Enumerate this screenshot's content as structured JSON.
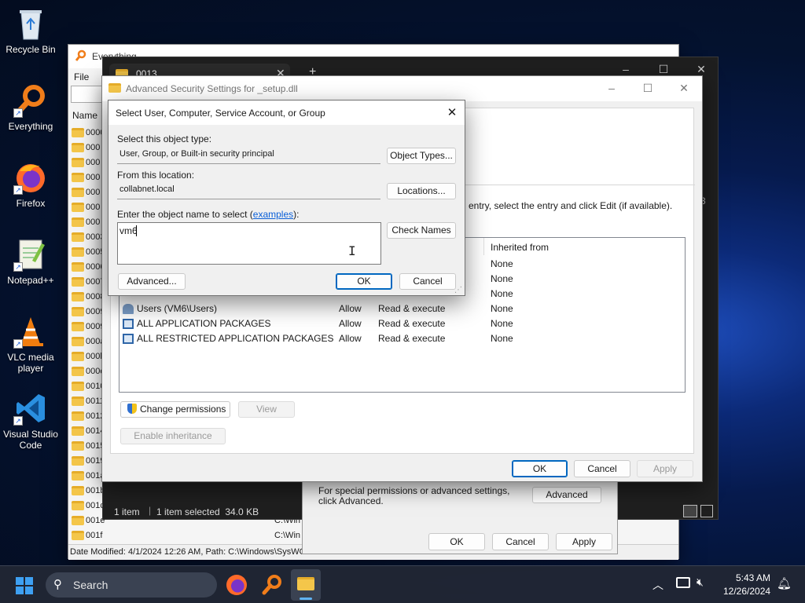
{
  "desktop": {
    "icons": [
      {
        "label": "Recycle Bin"
      },
      {
        "label": "Everything"
      },
      {
        "label": "Firefox"
      },
      {
        "label": "Notepad++"
      },
      {
        "label": "VLC media player"
      },
      {
        "label": "Visual Studio Code"
      }
    ]
  },
  "everything": {
    "title": "Everything",
    "menu_file": "File",
    "column_name": "Name",
    "rows": [
      "0000",
      "000",
      "000",
      "000",
      "000",
      "000",
      "000",
      "0003",
      "0005",
      "0006",
      "0007",
      "0008",
      "0009",
      "0009",
      "000a",
      "000b",
      "000e",
      "0010",
      "0011",
      "0012",
      "0014",
      "0015",
      "0019",
      "001a",
      "001b",
      "001c",
      "001e",
      "001f"
    ],
    "path_col_1": "C:\\Win",
    "path_col_2": "C:\\Win",
    "status": "Date Modified: 4/1/2024 12:26 AM, Path: C:\\Windows\\SysWO"
  },
  "explorer": {
    "tab_title": "0013",
    "status_items": "1 item",
    "status_selected": "1 item selected  34.0 KB",
    "right_hint": "3"
  },
  "props": {
    "special_text": "For special permissions or advanced settings, click Advanced.",
    "advanced_label": "Advanced",
    "ok_label": "OK",
    "cancel_label": "Cancel",
    "apply_label": "Apply"
  },
  "adv": {
    "title": "Advanced Security Settings for _setup.dll",
    "hint": "entry, select the entry and click Edit (if available).",
    "col_inherited": "Inherited from",
    "entries": [
      {
        "principal": "",
        "access": "",
        "type": "",
        "inherited": "None"
      },
      {
        "principal": "",
        "access": "",
        "type": "",
        "inherited": "None"
      },
      {
        "principal": "",
        "access": "",
        "type": "",
        "inherited": "None"
      },
      {
        "principal": "Users (VM6\\Users)",
        "type": "Allow",
        "access": "Read & execute",
        "inherited": "None"
      },
      {
        "principal": "ALL APPLICATION PACKAGES",
        "type": "Allow",
        "access": "Read & execute",
        "inherited": "None"
      },
      {
        "principal": "ALL RESTRICTED APPLICATION PACKAGES",
        "type": "Allow",
        "access": "Read & execute",
        "inherited": "None"
      }
    ],
    "change_permissions_label": "Change permissions",
    "view_label": "View",
    "enable_inheritance_label": "Enable inheritance",
    "ok_label": "OK",
    "cancel_label": "Cancel",
    "apply_label": "Apply"
  },
  "select": {
    "title": "Select User, Computer, Service Account, or Group",
    "object_type_label": "Select this object type:",
    "object_type_value": "User, Group, or Built-in security principal",
    "object_types_button": "Object Types...",
    "location_label": "From this location:",
    "location_value": "collabnet.local",
    "locations_button": "Locations...",
    "enter_name_prefix": "Enter the object name to select (",
    "examples_link": "examples",
    "enter_name_suffix": "):",
    "name_value": "vm6",
    "check_names_button": "Check Names",
    "advanced_button": "Advanced...",
    "ok_button": "OK",
    "cancel_button": "Cancel"
  },
  "taskbar": {
    "search_placeholder": "Search",
    "time": "5:43 AM",
    "date": "12/26/2024"
  },
  "colors": {
    "accent": "#0067c0",
    "link": "#0a5fd8",
    "folder": "#f4c64a"
  }
}
